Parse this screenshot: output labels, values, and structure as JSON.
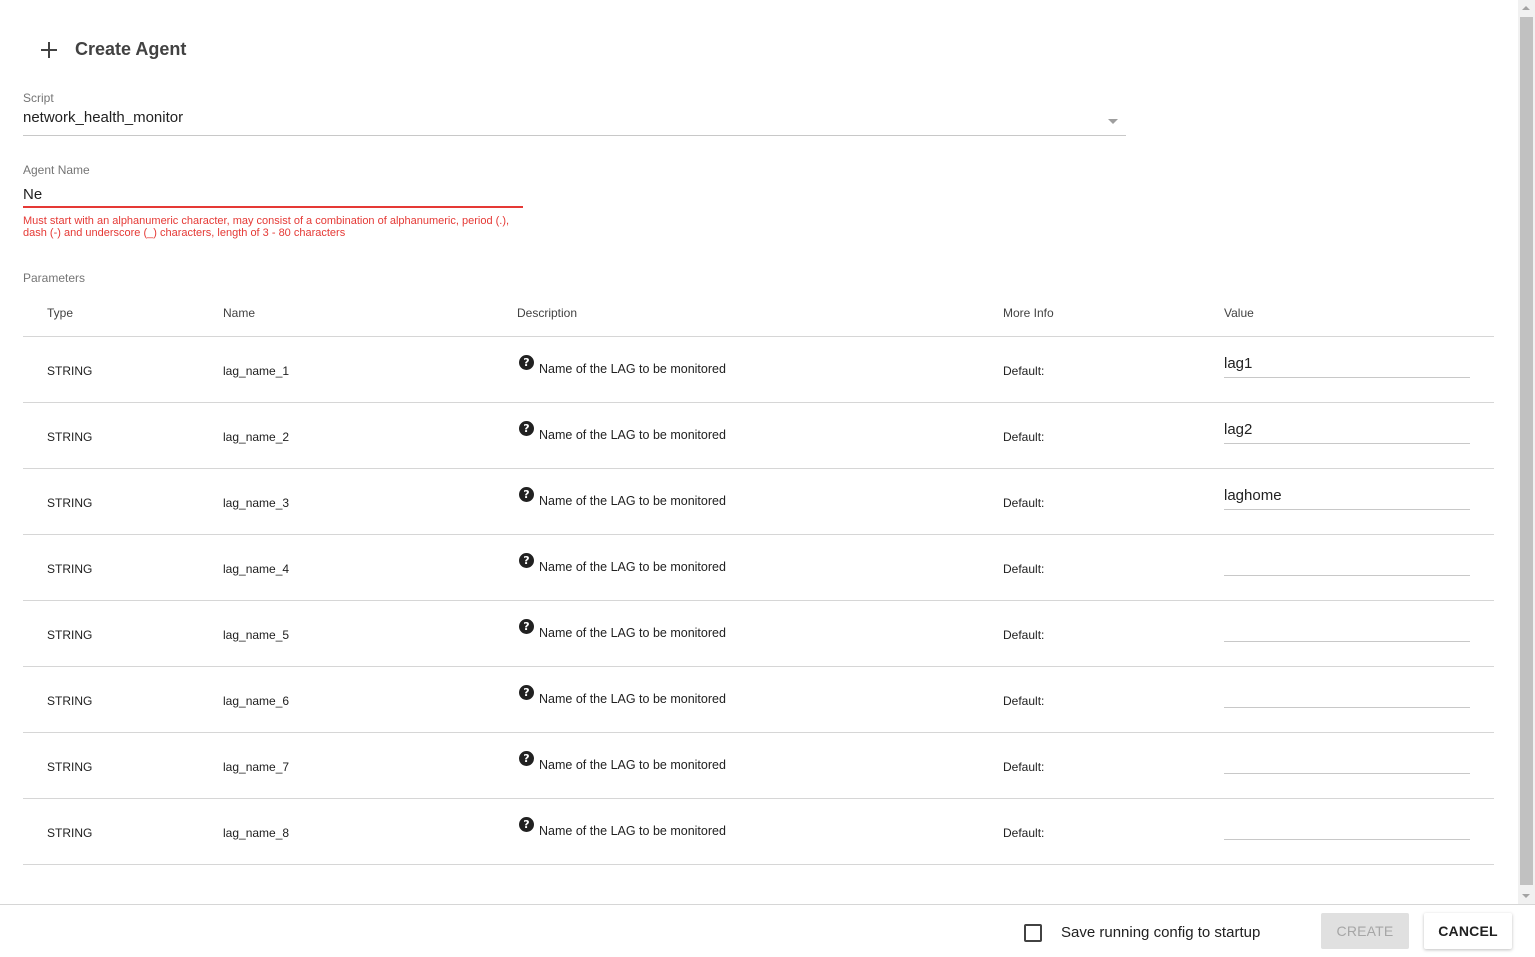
{
  "header": {
    "title": "Create Agent"
  },
  "script_field": {
    "label": "Script",
    "value": "network_health_monitor"
  },
  "agent_name_field": {
    "label": "Agent Name",
    "value": "Ne",
    "error": "Must start with an alphanumeric character, may consist of a combination of alphanumeric, period (.), dash (-) and underscore (_) characters, length of 3 - 80 characters"
  },
  "parameters": {
    "label": "Parameters",
    "columns": [
      "Type",
      "Name",
      "Description",
      "More Info",
      "Value"
    ],
    "rows": [
      {
        "type": "STRING",
        "name": "lag_name_1",
        "description": "Name of the LAG to be monitored",
        "more_info": "Default:",
        "value": "lag1"
      },
      {
        "type": "STRING",
        "name": "lag_name_2",
        "description": "Name of the LAG to be monitored",
        "more_info": "Default:",
        "value": "lag2"
      },
      {
        "type": "STRING",
        "name": "lag_name_3",
        "description": "Name of the LAG to be monitored",
        "more_info": "Default:",
        "value": "laghome"
      },
      {
        "type": "STRING",
        "name": "lag_name_4",
        "description": "Name of the LAG to be monitored",
        "more_info": "Default:",
        "value": ""
      },
      {
        "type": "STRING",
        "name": "lag_name_5",
        "description": "Name of the LAG to be monitored",
        "more_info": "Default:",
        "value": ""
      },
      {
        "type": "STRING",
        "name": "lag_name_6",
        "description": "Name of the LAG to be monitored",
        "more_info": "Default:",
        "value": ""
      },
      {
        "type": "STRING",
        "name": "lag_name_7",
        "description": "Name of the LAG to be monitored",
        "more_info": "Default:",
        "value": ""
      },
      {
        "type": "STRING",
        "name": "lag_name_8",
        "description": "Name of the LAG to be monitored",
        "more_info": "Default:",
        "value": ""
      }
    ]
  },
  "icons": {
    "add": "plus-icon",
    "help": "question-circle-icon",
    "dropdown": "caret-down-icon"
  },
  "footer": {
    "save_config_label": "Save running config to startup",
    "save_config_checked": false,
    "create_label": "CREATE",
    "create_disabled": true,
    "cancel_label": "CANCEL"
  },
  "colors": {
    "error": "#e53935",
    "text": "#212121",
    "muted": "#757575"
  }
}
